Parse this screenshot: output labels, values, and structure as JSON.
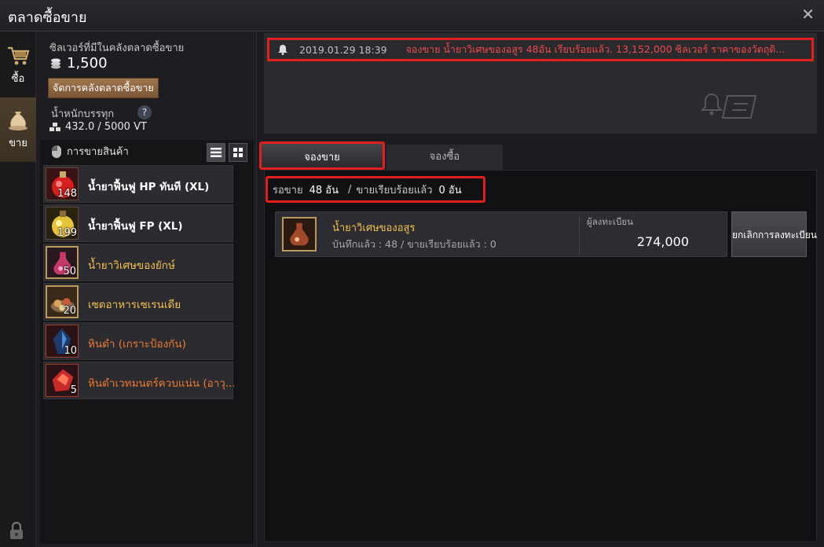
{
  "window": {
    "title": "ตลาดซื้อขาย",
    "close_icon": "close-icon"
  },
  "nav": {
    "buy_label": "ซื้อ",
    "sell_label": "ขาย",
    "buy_icon": "cart-icon",
    "sell_icon": "money-bag-icon",
    "lock_icon": "lock-icon"
  },
  "wallet": {
    "silver_label": "ซิลเวอร์ที่มีในคลังตลาดซื้อขาย",
    "silver_amount": "1,500",
    "manage_button": "จัดการคลังตลาดซื้อขาย",
    "weight_label": "น้ำหนักบรรทุก",
    "help": "?",
    "weight_value": "432.0 / 5000 VT"
  },
  "sell_list": {
    "header": "การขายสินค้า",
    "items": [
      {
        "name": "น้ำยาฟื้นฟู HP ทันที (XL)",
        "count": "148",
        "color": "white"
      },
      {
        "name": "น้ำยาฟื้นฟู FP (XL)",
        "count": "199",
        "color": "white"
      },
      {
        "name": "น้ำยาวิเศษของยักษ์",
        "count": "50",
        "color": "yellow"
      },
      {
        "name": "เซตอาหารเซเรนเดีย",
        "count": "20",
        "color": "yellow"
      },
      {
        "name": "หินดำ (เกราะป้องกัน)",
        "count": "10",
        "color": "orange"
      },
      {
        "name": "หินดำเวทมนตร์ควบแน่น (อาวุ...",
        "count": "5",
        "color": "orange"
      }
    ]
  },
  "notice": {
    "time": "2019.01.29 18:39",
    "message": "จองขาย น้ำยาวิเศษของอสูร 48อัน เรียบร้อยแล้ว. 13,152,000 ซิลเวอร์ ราคาของวัตถุดิ..."
  },
  "tabs": {
    "sell_reserve": "จองขาย",
    "buy_reserve": "จองซื้อ"
  },
  "counts": {
    "waiting_label": "รอขาย",
    "waiting_value": "48 อัน",
    "sold_label": "ขายเรียบร้อยแล้ว",
    "sold_value": "0 อัน"
  },
  "registration": {
    "item_name": "น้ำยาวิเศษของอสูร",
    "details": "บันทึกแล้ว : 48 / ขายเรียบร้อยแล้ว : 0",
    "price_label": "ผู้ลงทะเบียน",
    "price": "274,000",
    "cancel_button": "ยกเลิกการลงทะเบียน"
  },
  "colors": {
    "accent_red": "#e01f1f",
    "gold": "#f2c14e",
    "orange": "#ee7a33"
  }
}
